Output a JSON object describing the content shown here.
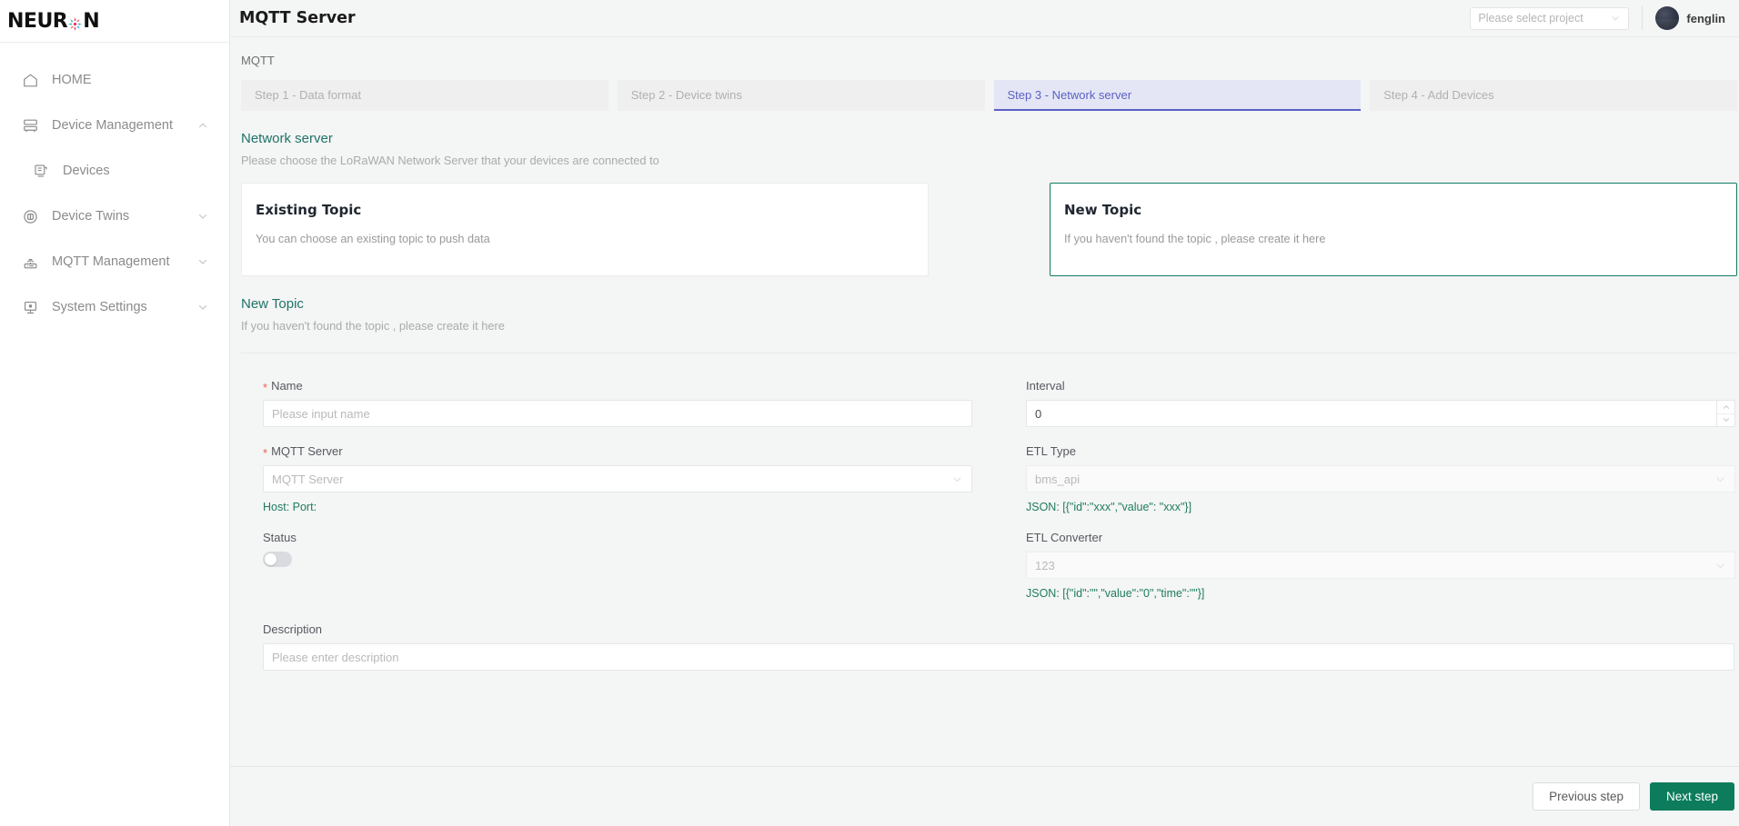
{
  "brand": {
    "name_part1": "NEUR",
    "name_part2": "N",
    "logo_icon": "neuron-flower-icon"
  },
  "sidebar": {
    "items": [
      {
        "label": "HOME",
        "icon": "home-icon",
        "expandable": false,
        "sub": false
      },
      {
        "label": "Device Management",
        "icon": "server-rack-icon",
        "expandable": true,
        "expanded": true,
        "sub": false
      },
      {
        "label": "Devices",
        "icon": "device-board-icon",
        "expandable": false,
        "sub": true
      },
      {
        "label": "Device Twins",
        "icon": "twins-circle-icon",
        "expandable": true,
        "expanded": false,
        "sub": false
      },
      {
        "label": "MQTT Management",
        "icon": "router-wifi-icon",
        "expandable": true,
        "expanded": false,
        "sub": false
      },
      {
        "label": "System Settings",
        "icon": "monitor-gear-icon",
        "expandable": true,
        "expanded": false,
        "sub": false
      }
    ]
  },
  "header": {
    "title": "MQTT Server",
    "project_select_placeholder": "Please select project",
    "username": "fenglin",
    "avatar_icon": "user-avatar",
    "chevron_icon": "chevron-down-icon"
  },
  "breadcrumb": "MQTT",
  "steps": [
    {
      "label": "Step 1 - Data format",
      "active": false
    },
    {
      "label": "Step 2 - Device twins",
      "active": false
    },
    {
      "label": "Step 3 - Network server",
      "active": true
    },
    {
      "label": "Step 4 - Add Devices",
      "active": false
    }
  ],
  "network_server": {
    "title": "Network server",
    "subtitle": "Please choose the LoRaWAN Network Server that your devices are connected to"
  },
  "topic_cards": [
    {
      "title": "Existing Topic",
      "desc": "You can choose an existing topic to push data",
      "selected": false
    },
    {
      "title": "New Topic",
      "desc": "If you haven't found the topic , please create it here",
      "selected": true
    }
  ],
  "new_topic": {
    "title": "New Topic",
    "subtitle": "If you haven't found the topic , please create it here"
  },
  "form": {
    "name": {
      "label": "Name",
      "required": true,
      "placeholder": "Please input name",
      "value": ""
    },
    "interval": {
      "label": "Interval",
      "required": false,
      "value": "0"
    },
    "mqtt_server": {
      "label": "MQTT Server",
      "required": true,
      "placeholder": "MQTT Server",
      "hint": "Host:  Port:"
    },
    "etl_type": {
      "label": "ETL Type",
      "required": false,
      "value": "bms_api",
      "hint": "JSON: [{\"id\":\"xxx\",\"value\":  \"xxx\"}]"
    },
    "status": {
      "label": "Status",
      "enabled": false
    },
    "etl_converter": {
      "label": "ETL Converter",
      "required": false,
      "value": "123",
      "hint": "JSON: [{\"id\":\"\",\"value\":\"0\",\"time\":\"\"}]"
    },
    "description": {
      "label": "Description",
      "placeholder": "Please enter description",
      "value": ""
    }
  },
  "footer": {
    "previous_label": "Previous step",
    "next_label": "Next step"
  },
  "colors": {
    "accent_green": "#0c7c5c",
    "teal_heading": "#1f7368",
    "active_step_bg": "#e4e6f5",
    "active_step_text": "#5b60c6",
    "required_red": "#f15b50",
    "hint_green": "#1f7c5f"
  }
}
